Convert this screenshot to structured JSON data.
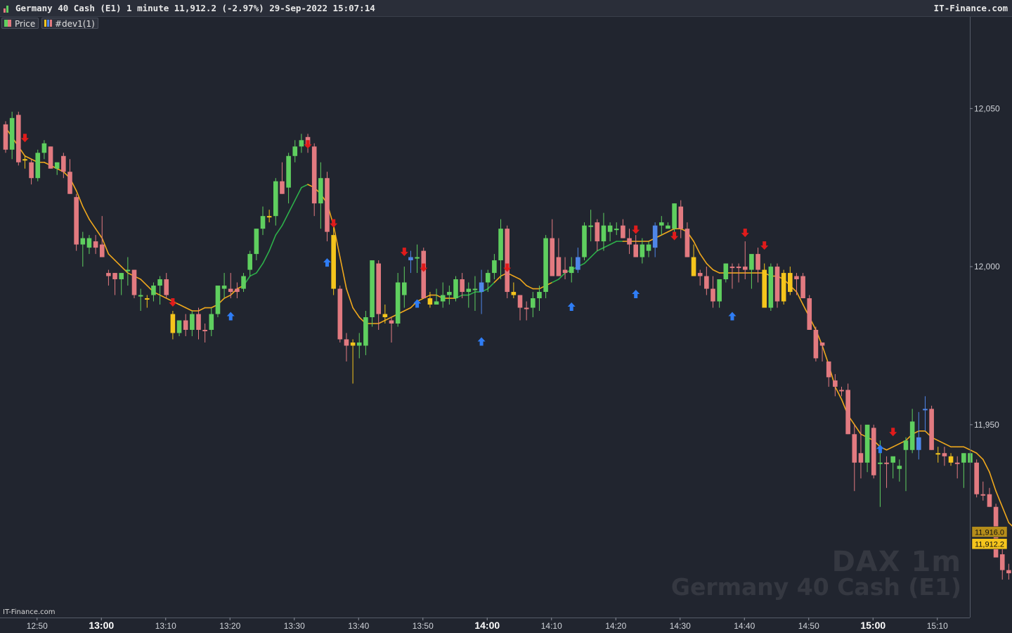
{
  "header": {
    "title": "Germany 40 Cash (E1) 1 minute 11,912.2 (-2.97%) 29-Sep-2022 15:07:14",
    "brand": "IT-Finance.com"
  },
  "legend": {
    "price_label": "Price",
    "indicator_label": "#dev1(1)"
  },
  "footer": {
    "brand": "IT-Finance.com"
  },
  "watermark": {
    "line1": "DAX 1m",
    "line2": "Germany 40 Cash (E1)"
  },
  "colors": {
    "background": "#21252f",
    "up": "#5fcf5f",
    "down": "#e27a80",
    "highlight": "#f5c51c",
    "blue_candle": "#4f86e8",
    "ma_down": "#f0a81c",
    "ma_up": "#2db04a",
    "arrow_up": "#2f7df5",
    "arrow_down": "#e01b1b",
    "label_ma_bg": "#b58d1a",
    "label_price_bg": "#f5c51c"
  },
  "chart_data": {
    "type": "candlestick",
    "interval": "1 minute",
    "ylim": [
      11889,
      12079
    ],
    "yticks": [
      12050,
      12000,
      11950
    ],
    "ytick_labels": [
      "12,050",
      "12,000",
      "11,950"
    ],
    "xticks": [
      "12:50",
      "13:00",
      "13:10",
      "13:20",
      "13:30",
      "13:40",
      "13:50",
      "14:00",
      "14:10",
      "14:20",
      "14:30",
      "14:40",
      "14:50",
      "15:00",
      "15:10"
    ],
    "xticks_bold": [
      "13:00",
      "14:00",
      "15:00"
    ],
    "current_price": 11912.2,
    "current_price_label": "11,912.2",
    "ma_value": 11916.0,
    "ma_value_label": "11,916.0",
    "candles": [
      [
        12045,
        12046,
        12036,
        12037,
        "d"
      ],
      [
        12037,
        12049,
        12034,
        12047,
        "u"
      ],
      [
        12048,
        12049,
        12032,
        12033,
        "d"
      ],
      [
        12034,
        12035,
        12031,
        12034,
        "y"
      ],
      [
        12033,
        12034,
        12026,
        12028,
        "d"
      ],
      [
        12028,
        12037,
        12027,
        12036,
        "u"
      ],
      [
        12036,
        12040,
        12034,
        12039,
        "u"
      ],
      [
        12038,
        12038,
        12031,
        12031,
        "d"
      ],
      [
        12031,
        12033,
        12029,
        12033,
        "u"
      ],
      [
        12035,
        12036,
        12028,
        12030,
        "d"
      ],
      [
        12030,
        12034,
        12023,
        12023,
        "d"
      ],
      [
        12022,
        12023,
        12005,
        12007,
        "d"
      ],
      [
        12007,
        12011,
        12000,
        12009,
        "u"
      ],
      [
        12009,
        12010,
        12004,
        12006,
        "u"
      ],
      [
        12006,
        12010,
        12004,
        12008,
        "d"
      ],
      [
        12007,
        12016,
        12004,
        12003,
        "d"
      ],
      [
        11997,
        11999,
        11994,
        11998,
        "d"
      ],
      [
        11998,
        11998,
        11991,
        11996,
        "d"
      ],
      [
        11996,
        11998,
        11991,
        11998,
        "u"
      ],
      [
        11999,
        12003,
        11994,
        11999,
        "u"
      ],
      [
        11999,
        11999,
        11990,
        11991,
        "d"
      ],
      [
        11991,
        11993,
        11986,
        11991,
        "u"
      ],
      [
        11990,
        11991,
        11987,
        11990,
        "y"
      ],
      [
        11991,
        11995,
        11989,
        11994,
        "u"
      ],
      [
        11994,
        11997,
        11988,
        11996,
        "u"
      ],
      [
        11996,
        11998,
        11990,
        11991,
        "d"
      ],
      [
        11985,
        11986,
        11977,
        11979,
        "y"
      ],
      [
        11979,
        11983,
        11978,
        11983,
        "u"
      ],
      [
        11983,
        11985,
        11978,
        11980,
        "d"
      ],
      [
        11980,
        11986,
        11978,
        11985,
        "u"
      ],
      [
        11985,
        11987,
        11977,
        11980,
        "d"
      ],
      [
        11980,
        11982,
        11976,
        11980,
        "d"
      ],
      [
        11980,
        11987,
        11978,
        11985,
        "u"
      ],
      [
        11985,
        11993,
        11984,
        11994,
        "u"
      ],
      [
        11994,
        11998,
        11990,
        11993,
        "u"
      ],
      [
        11993,
        11998,
        11990,
        11992,
        "d"
      ],
      [
        11992,
        11995,
        11990,
        11993,
        "d"
      ],
      [
        11993,
        11998,
        11992,
        11997,
        "u"
      ],
      [
        11999,
        12005,
        11997,
        12004,
        "u"
      ],
      [
        12004,
        12012,
        12002,
        12012,
        "u"
      ],
      [
        12012,
        12019,
        12010,
        12016,
        "u"
      ],
      [
        12016,
        12018,
        12014,
        12016,
        "y"
      ],
      [
        12016,
        12028,
        12013,
        12027,
        "u"
      ],
      [
        12027,
        12033,
        12023,
        12023,
        "d"
      ],
      [
        12025,
        12036,
        12020,
        12035,
        "u"
      ],
      [
        12035,
        12040,
        12033,
        12038,
        "u"
      ],
      [
        12038,
        12042,
        12036,
        12040,
        "u"
      ],
      [
        12041,
        12042,
        12036,
        12038,
        "d"
      ],
      [
        12038,
        12039,
        12016,
        12020,
        "d"
      ],
      [
        12020,
        12033,
        12012,
        12028,
        "u"
      ],
      [
        12028,
        12030,
        12008,
        12011,
        "d"
      ],
      [
        12010,
        12013,
        11991,
        11993,
        "y"
      ],
      [
        11993,
        11994,
        11976,
        11977,
        "d"
      ],
      [
        11977,
        11979,
        11970,
        11975,
        "d"
      ],
      [
        11975,
        11977,
        11963,
        11976,
        "y"
      ],
      [
        11976,
        11979,
        11971,
        11975,
        "u"
      ],
      [
        11975,
        11986,
        11972,
        11984,
        "u"
      ],
      [
        11984,
        11992,
        11981,
        12002,
        "u"
      ],
      [
        12001,
        12002,
        11980,
        11985,
        "d"
      ],
      [
        11985,
        11988,
        11982,
        11984,
        "y"
      ],
      [
        11983,
        11984,
        11976,
        11982,
        "d"
      ],
      [
        11982,
        11998,
        11981,
        11995,
        "u"
      ],
      [
        11995,
        12000,
        11987,
        11991,
        "u"
      ],
      [
        12002,
        12005,
        11998,
        12003,
        "b"
      ],
      [
        12003,
        12007,
        11998,
        12003,
        "u"
      ],
      [
        12005,
        12006,
        11992,
        11990,
        "d"
      ],
      [
        11990,
        11992,
        11987,
        11988,
        "y"
      ],
      [
        11988,
        11993,
        11988,
        11989,
        "u"
      ],
      [
        11989,
        11995,
        11987,
        11991,
        "u"
      ],
      [
        11991,
        11994,
        11988,
        11992,
        "u"
      ],
      [
        11990,
        11997,
        11989,
        11996,
        "u"
      ],
      [
        11996,
        11998,
        11990,
        11992,
        "d"
      ],
      [
        11992,
        11995,
        11987,
        11993,
        "u"
      ],
      [
        11993,
        11997,
        11986,
        11993,
        "u"
      ],
      [
        11992,
        11999,
        11985,
        11995,
        "b"
      ],
      [
        11995,
        11999,
        11992,
        11998,
        "u"
      ],
      [
        11998,
        12004,
        11996,
        12002,
        "u"
      ],
      [
        12002,
        12015,
        11996,
        12012,
        "u"
      ],
      [
        12012,
        12013,
        11990,
        11992,
        "d"
      ],
      [
        11992,
        11995,
        11990,
        11991,
        "y"
      ],
      [
        11991,
        11991,
        11983,
        11987,
        "d"
      ],
      [
        11987,
        11989,
        11983,
        11987,
        "d"
      ],
      [
        11987,
        11992,
        11984,
        11990,
        "u"
      ],
      [
        11990,
        11994,
        11986,
        11992,
        "u"
      ],
      [
        11992,
        12010,
        11990,
        12009,
        "u"
      ],
      [
        12009,
        12015,
        12004,
        11997,
        "d"
      ],
      [
        11997,
        12009,
        11997,
        12003,
        "d"
      ],
      [
        11999,
        12003,
        11996,
        11998,
        "d"
      ],
      [
        11998,
        12003,
        11995,
        12000,
        "u"
      ],
      [
        11999,
        12006,
        11998,
        12003,
        "b"
      ],
      [
        12003,
        12014,
        12002,
        12013,
        "u"
      ],
      [
        12013,
        12018,
        12008,
        12013,
        "u"
      ],
      [
        12014,
        12015,
        12005,
        12008,
        "d"
      ],
      [
        12008,
        12017,
        12005,
        12013,
        "u"
      ],
      [
        12011,
        12014,
        12008,
        12013,
        "u"
      ],
      [
        12012,
        12014,
        12010,
        12012,
        "u"
      ],
      [
        12013,
        12015,
        12009,
        12009,
        "d"
      ],
      [
        12009,
        12012,
        12004,
        12007,
        "d"
      ],
      [
        12007,
        12010,
        12003,
        12003,
        "d"
      ],
      [
        12003,
        12009,
        12001,
        12007,
        "u"
      ],
      [
        12005,
        12008,
        12003,
        12007,
        "u"
      ],
      [
        12006,
        12014,
        12003,
        12013,
        "b"
      ],
      [
        12014,
        12016,
        12010,
        12013,
        "u"
      ],
      [
        12013,
        12014,
        12012,
        12012,
        "u"
      ],
      [
        12012,
        12020,
        12011,
        12020,
        "u"
      ],
      [
        12019,
        12021,
        12009,
        12012,
        "d"
      ],
      [
        12012,
        12014,
        12003,
        12003,
        "d"
      ],
      [
        12003,
        12007,
        11997,
        11997,
        "y"
      ],
      [
        11998,
        11999,
        11994,
        11997,
        "d"
      ],
      [
        11997,
        12000,
        11991,
        11993,
        "d"
      ],
      [
        11993,
        11997,
        11987,
        11989,
        "d"
      ],
      [
        11989,
        11995,
        11987,
        11996,
        "u"
      ],
      [
        11996,
        12001,
        11995,
        12001,
        "u"
      ],
      [
        12000,
        12001,
        11993,
        12000,
        "d"
      ],
      [
        12000,
        12001,
        11995,
        12000,
        "d"
      ],
      [
        12000,
        12008,
        11996,
        11999,
        "d"
      ],
      [
        11999,
        12002,
        11993,
        12004,
        "u"
      ],
      [
        12004,
        12006,
        11995,
        11999,
        "d"
      ],
      [
        11999,
        12001,
        11987,
        11987,
        "y"
      ],
      [
        11987,
        12001,
        11986,
        12000,
        "u"
      ],
      [
        12000,
        12001,
        11987,
        11989,
        "d"
      ],
      [
        11989,
        11999,
        11988,
        11998,
        "y"
      ],
      [
        11998,
        12000,
        11991,
        11992,
        "y"
      ],
      [
        11996,
        11998,
        11991,
        11997,
        "d"
      ],
      [
        11997,
        11998,
        11990,
        11990,
        "d"
      ],
      [
        11990,
        11991,
        11980,
        11980,
        "d"
      ],
      [
        11980,
        11981,
        11970,
        11971,
        "d"
      ],
      [
        11975,
        11976,
        11970,
        11976,
        "d"
      ],
      [
        11970,
        11969,
        11962,
        11965,
        "d"
      ],
      [
        11964,
        11966,
        11959,
        11962,
        "d"
      ],
      [
        11961,
        11962,
        11959,
        11961,
        "d"
      ],
      [
        11961,
        11963,
        11947,
        11947,
        "d"
      ],
      [
        11947,
        11950,
        11929,
        11938,
        "d"
      ],
      [
        11941,
        11950,
        11933,
        11938,
        "d"
      ],
      [
        11938,
        11940,
        11935,
        11950,
        "u"
      ],
      [
        11949,
        11950,
        11933,
        11934,
        "d"
      ],
      [
        11938,
        11945,
        11924,
        11938,
        "u"
      ],
      [
        11938,
        11940,
        11930,
        11938,
        "d"
      ],
      [
        11938,
        11939,
        11933,
        11940,
        "u"
      ],
      [
        11937,
        11939,
        11932,
        11936,
        "u"
      ],
      [
        11945,
        11946,
        11929,
        11942,
        "u"
      ],
      [
        11942,
        11955,
        11941,
        11951,
        "u"
      ],
      [
        11946,
        11954,
        11939,
        11942,
        "b"
      ],
      [
        11955,
        11959,
        11948,
        11955,
        "b"
      ],
      [
        11955,
        11956,
        11942,
        11942,
        "d"
      ],
      [
        11941,
        11943,
        11938,
        11941,
        "y"
      ],
      [
        11940,
        11943,
        11937,
        11941,
        "d"
      ],
      [
        11940,
        11941,
        11937,
        11938,
        "y"
      ],
      [
        11938,
        11940,
        11933,
        11938,
        "d"
      ],
      [
        11938,
        11941,
        11930,
        11941,
        "u"
      ],
      [
        11941,
        11942,
        11929,
        11938,
        "u"
      ],
      [
        11938,
        11939,
        11927,
        11928,
        "d"
      ],
      [
        11928,
        11932,
        11926,
        11928,
        "d"
      ],
      [
        11928,
        11930,
        11924,
        11924,
        "d"
      ],
      [
        11924,
        11925,
        11918,
        11908,
        "d"
      ],
      [
        11909,
        11912,
        11901,
        11904,
        "d"
      ],
      [
        11904,
        11906,
        11901,
        11903,
        "d"
      ],
      [
        11901,
        11906,
        11900,
        11906,
        "u"
      ],
      [
        11908,
        11917,
        11908,
        11917,
        "u"
      ],
      [
        11915,
        11917,
        11910,
        11916,
        "y"
      ],
      [
        11916,
        11918,
        11911,
        11912,
        "d"
      ]
    ],
    "ma": [
      12044,
      12041,
      12038,
      12035,
      12034,
      12033,
      12033,
      12032,
      12031,
      12030,
      12028,
      12024,
      12019,
      12015,
      12012,
      12009,
      12004,
      12002,
      12000,
      11998,
      11997,
      11996,
      11994,
      11992,
      11991,
      11990,
      11989,
      11988,
      11987,
      11986,
      11986,
      11987,
      11987,
      11988,
      11990,
      11991,
      11993,
      11994,
      11997,
      11998,
      12001,
      12005,
      12010,
      12013,
      12017,
      12021,
      12025,
      12026,
      12025,
      12023,
      12020,
      12013,
      12003,
      11993,
      11987,
      11984,
      11982,
      11982,
      11982,
      11983,
      11984,
      11985,
      11986,
      11987,
      11989,
      11990,
      11991,
      11991,
      11990,
      11990,
      11990,
      11991,
      11991,
      11992,
      11992,
      11993,
      11995,
      11997,
      11998,
      11997,
      11996,
      11994,
      11993,
      11993,
      11994,
      11995,
      11996,
      11998,
      11999,
      12000,
      12001,
      12003,
      12005,
      12006,
      12007,
      12008,
      12008,
      12008,
      12008,
      12008,
      12008,
      12009,
      12010,
      12011,
      12012,
      12012,
      12011,
      12008,
      12004,
      12001,
      11999,
      11998,
      11998,
      11998,
      11998,
      11998,
      11998,
      11998,
      11998,
      11997,
      11997,
      11996,
      11994,
      11992,
      11988,
      11984,
      11980,
      11975,
      11969,
      11962,
      11958,
      11953,
      11950,
      11947,
      11946,
      11945,
      11943,
      11942,
      11943,
      11944,
      11945,
      11947,
      11948,
      11948,
      11946,
      11945,
      11944,
      11943,
      11943,
      11943,
      11942,
      11941,
      11939,
      11935,
      11929,
      11924,
      11919,
      11917,
      11916,
      11916,
      11916
    ],
    "arrows_down": [
      [
        3,
        12040
      ],
      [
        26,
        11988
      ],
      [
        47,
        12038
      ],
      [
        51,
        12013
      ],
      [
        62,
        12004
      ],
      [
        65,
        11999
      ],
      [
        78,
        11999
      ],
      [
        98,
        12011
      ],
      [
        104,
        12009
      ],
      [
        115,
        12010
      ],
      [
        118,
        12006
      ],
      [
        138,
        11947
      ]
    ],
    "arrows_up": [
      [
        35,
        11985
      ],
      [
        50,
        12002
      ],
      [
        64,
        11989
      ],
      [
        74,
        11977
      ],
      [
        88,
        11988
      ],
      [
        98,
        11992
      ],
      [
        113,
        11985
      ],
      [
        136,
        11943
      ]
    ]
  }
}
